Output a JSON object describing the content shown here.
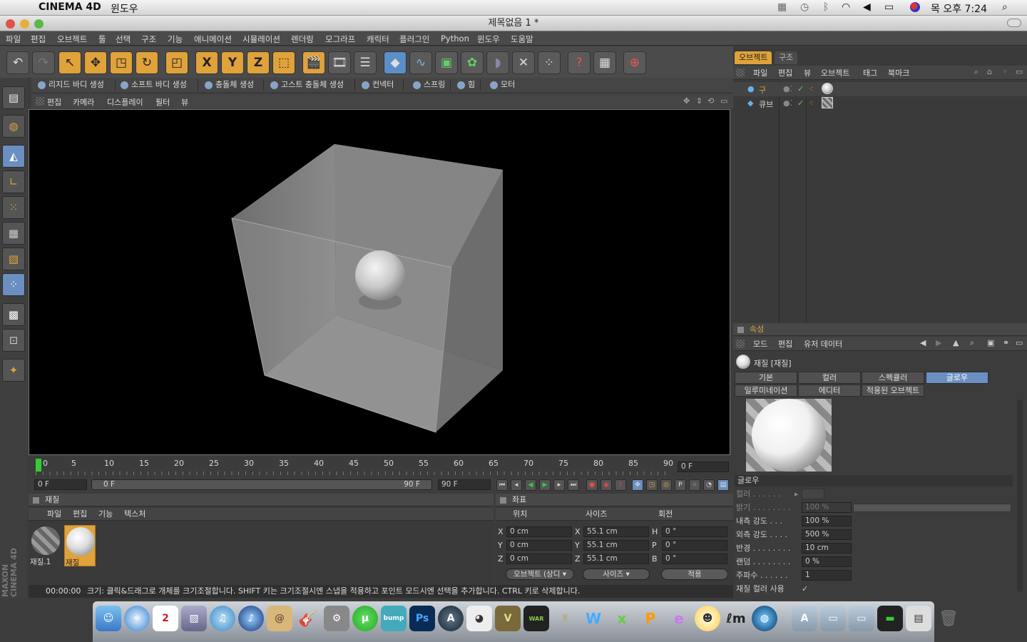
{
  "macmenu": {
    "app": "CINEMA 4D",
    "window_menu": "윈도우",
    "clock": "목 오후 7:24"
  },
  "window": {
    "title": "제목없음 1 *"
  },
  "menubar": [
    "파일",
    "편집",
    "오브젝트",
    "툴",
    "선택",
    "구조",
    "기능",
    "애니메이션",
    "시뮬레이션",
    "렌더링",
    "모그라프",
    "캐릭터",
    "플러그인",
    "Python",
    "윈도우",
    "도움말"
  ],
  "toolbar": {
    "axis_labels": [
      "X",
      "Y",
      "Z"
    ],
    "icons": [
      "undo-icon",
      "redo-icon",
      "live-select-icon",
      "move-icon",
      "scale-icon",
      "rotate-icon",
      "model-mode-icon",
      "x-axis-icon",
      "y-axis-icon",
      "z-axis-icon",
      "world-coord-icon",
      "render-view-icon",
      "render-picture-viewer-icon",
      "render-settings-icon",
      "cube-primitive-icon",
      "spline-icon",
      "nurbs-icon",
      "array-icon",
      "deformer-icon",
      "scene-icon",
      "particle-icon",
      "help-icon",
      "camera-icon",
      "web-icon"
    ]
  },
  "simbar": [
    "리지드 바디 생성",
    "소프트 바디 생성",
    "충돌체 생성",
    "고스트 충돌체 생성",
    "컨넥터",
    "스프링",
    "힘",
    "모터"
  ],
  "viewport": {
    "menu": [
      "편집",
      "카메라",
      "디스플레이",
      "필터",
      "뷰"
    ]
  },
  "timeline": {
    "ticks": [
      "0",
      "5",
      "10",
      "15",
      "20",
      "25",
      "30",
      "35",
      "40",
      "45",
      "50",
      "55",
      "60",
      "65",
      "70",
      "75",
      "80",
      "85",
      "90"
    ],
    "current_frame": "0 F",
    "start": "0 F",
    "range_left": "0 F",
    "range_right": "90 F",
    "end": "90 F"
  },
  "materials": {
    "title": "재질",
    "menu": [
      "파일",
      "편집",
      "기능",
      "텍스처"
    ],
    "items": [
      {
        "name": "재질.1"
      },
      {
        "name": "재질"
      }
    ]
  },
  "coords": {
    "title": "좌표",
    "headers": [
      "위치",
      "사이즈",
      "회전"
    ],
    "rows": [
      {
        "axis": "X",
        "pos": "0 cm",
        "size_axis": "X",
        "size": "55.1 cm",
        "rot_axis": "H",
        "rot": "0 °"
      },
      {
        "axis": "Y",
        "pos": "0 cm",
        "size_axis": "Y",
        "size": "55.1 cm",
        "rot_axis": "P",
        "rot": "0 °"
      },
      {
        "axis": "Z",
        "pos": "0 cm",
        "size_axis": "Z",
        "size": "55.1 cm",
        "rot_axis": "B",
        "rot": "0 °"
      }
    ],
    "mode_select": "오브젝트 (상디",
    "size_select": "사이즈",
    "apply": "적용"
  },
  "status": {
    "time": "00:00:00",
    "text": "크기: 클릭&드래그로 개체를 크기조절합니다. SHIFT 키는 크기조절시엔 스냅을 적용하고 포인트 모드시엔 선택을 추가합니다. CTRL 키로 삭제합니다."
  },
  "object_manager": {
    "tabs": [
      "오브젝트",
      "구조"
    ],
    "menu": [
      "파일",
      "편집",
      "뷰",
      "오브젝트",
      "태그",
      "북마크"
    ],
    "objects": [
      {
        "name": "구"
      },
      {
        "name": "큐브"
      }
    ]
  },
  "attributes": {
    "title": "속성",
    "menu": [
      "모드",
      "편집",
      "유저 데이터"
    ],
    "material_name": "재질 [재질]",
    "tabs_row1": [
      "기본",
      "컬러",
      "스펙큘러",
      "글로우"
    ],
    "tabs_row2": [
      "일루미네이션",
      "에디터",
      "적용된 오브젝트"
    ],
    "active_tab": "글로우",
    "section": "글로우",
    "props": [
      {
        "label": "컬러 . . . . . .",
        "value": ""
      },
      {
        "label": "밝기 . . . . . . . .",
        "value": "100 %"
      },
      {
        "label": "내측 강도 . . .",
        "value": "100 %"
      },
      {
        "label": "외측 강도 . . . .",
        "value": "500 %"
      },
      {
        "label": "반경 . . . . . . . .",
        "value": "10 cm"
      },
      {
        "label": "랜덤 . . . . . . . .",
        "value": "0 %"
      },
      {
        "label": "주파수 . . . . . .",
        "value": "1"
      },
      {
        "label": "재질 컬러 사용",
        "value": "✓"
      }
    ]
  },
  "branding": "MAXON CINEMA 4D",
  "dock": [
    "Finder",
    "Safari",
    "iCal",
    "iPhoto",
    "iTunes",
    "iTunes2",
    "Mail",
    "GarageBand",
    "System Preferences",
    "uTorrent",
    "Bumptop",
    "Photoshop",
    "Assassin's Creed",
    "Panda",
    "Civilization V",
    "Dawn of War",
    "Game",
    "ProWord",
    "Stickies",
    "ProPaint",
    "Pencil",
    "Chat",
    "Lm",
    "Globe",
    "Apps",
    "Documents",
    "Downloads",
    "Terminal",
    "Preview",
    "Trash"
  ]
}
